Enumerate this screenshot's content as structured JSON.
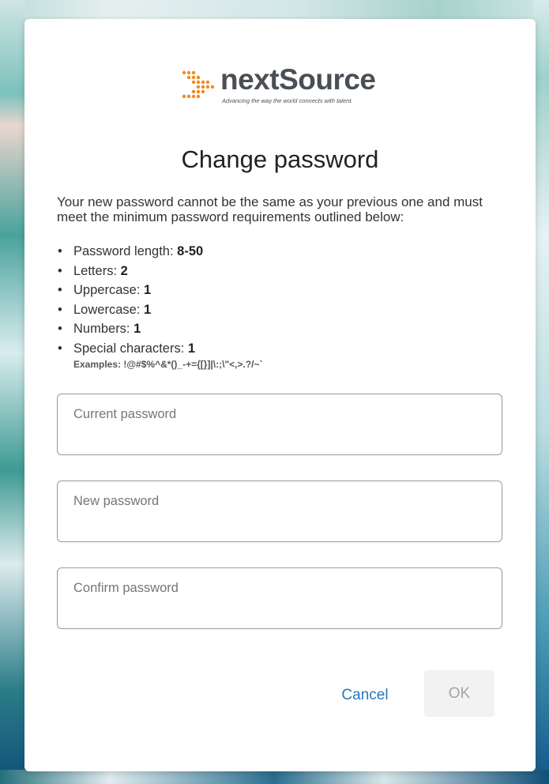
{
  "brand": {
    "name": "nextSource",
    "tagline": "Advancing the way the world connects with talent.",
    "colors": {
      "dots": "#f28a1c",
      "wordmark": "#4a4f55"
    }
  },
  "dialog": {
    "title": "Change password",
    "intro": "Your new password cannot be the same as your previous one and must meet the minimum password requirements outlined below:",
    "rules": [
      {
        "label": "Password length: ",
        "value": "8-50"
      },
      {
        "label": "Letters: ",
        "value": "2"
      },
      {
        "label": "Uppercase: ",
        "value": "1"
      },
      {
        "label": "Lowercase: ",
        "value": "1"
      },
      {
        "label": "Numbers: ",
        "value": "1"
      },
      {
        "label": "Special characters: ",
        "value": "1"
      }
    ],
    "examples": "Examples: !@#$%^&*()_-+={[}]|\\:;\\\"<,>.?/~`",
    "fields": {
      "current_placeholder": "Current password",
      "new_placeholder": "New password",
      "confirm_placeholder": "Confirm password"
    },
    "buttons": {
      "cancel": "Cancel",
      "ok": "OK"
    },
    "colors": {
      "link": "#2878bb",
      "disabled_bg": "#f2f2f2",
      "disabled_text": "#a5a5a5"
    }
  }
}
